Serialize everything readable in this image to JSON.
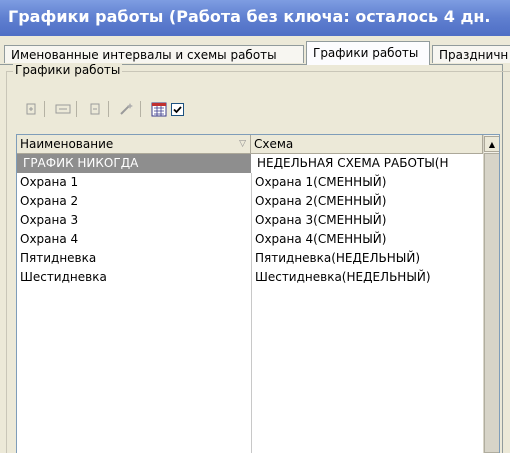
{
  "window": {
    "title": "Графики работы (Работа без ключа: осталось 4 дн."
  },
  "tabs": [
    {
      "label": "Именованные интервалы и схемы работы"
    },
    {
      "label": "Графики работы"
    },
    {
      "label": "Праздничн"
    }
  ],
  "group": {
    "legend": "Графики работы"
  },
  "toolbar": {
    "icons": [
      "add-icon",
      "edit-icon",
      "remove-icon",
      "wizard-icon",
      "calendar-icon"
    ],
    "checkbox_checked": true
  },
  "table": {
    "columns": [
      "Наименование",
      "Схема"
    ],
    "rows": [
      {
        "name": "ГРАФИК НИКОГДА",
        "scheme": "НЕДЕЛЬНАЯ СХЕМА РАБОТЫ(Н"
      },
      {
        "name": "Охрана 1",
        "scheme": "Охрана 1(СМЕННЫЙ)"
      },
      {
        "name": "Охрана 2",
        "scheme": "Охрана 2(СМЕННЫЙ)"
      },
      {
        "name": "Охрана 3",
        "scheme": "Охрана 3(СМЕННЫЙ)"
      },
      {
        "name": "Охрана 4",
        "scheme": "Охрана 4(СМЕННЫЙ)"
      },
      {
        "name": "Пятидневка",
        "scheme": "Пятидневка(НЕДЕЛЬНЫЙ)"
      },
      {
        "name": "Шестидневка",
        "scheme": "Шестидневка(НЕДЕЛЬНЫЙ)"
      }
    ]
  },
  "colors": {
    "titlebar": "#5f7fd0",
    "selected_row": "#8e8e8e"
  }
}
